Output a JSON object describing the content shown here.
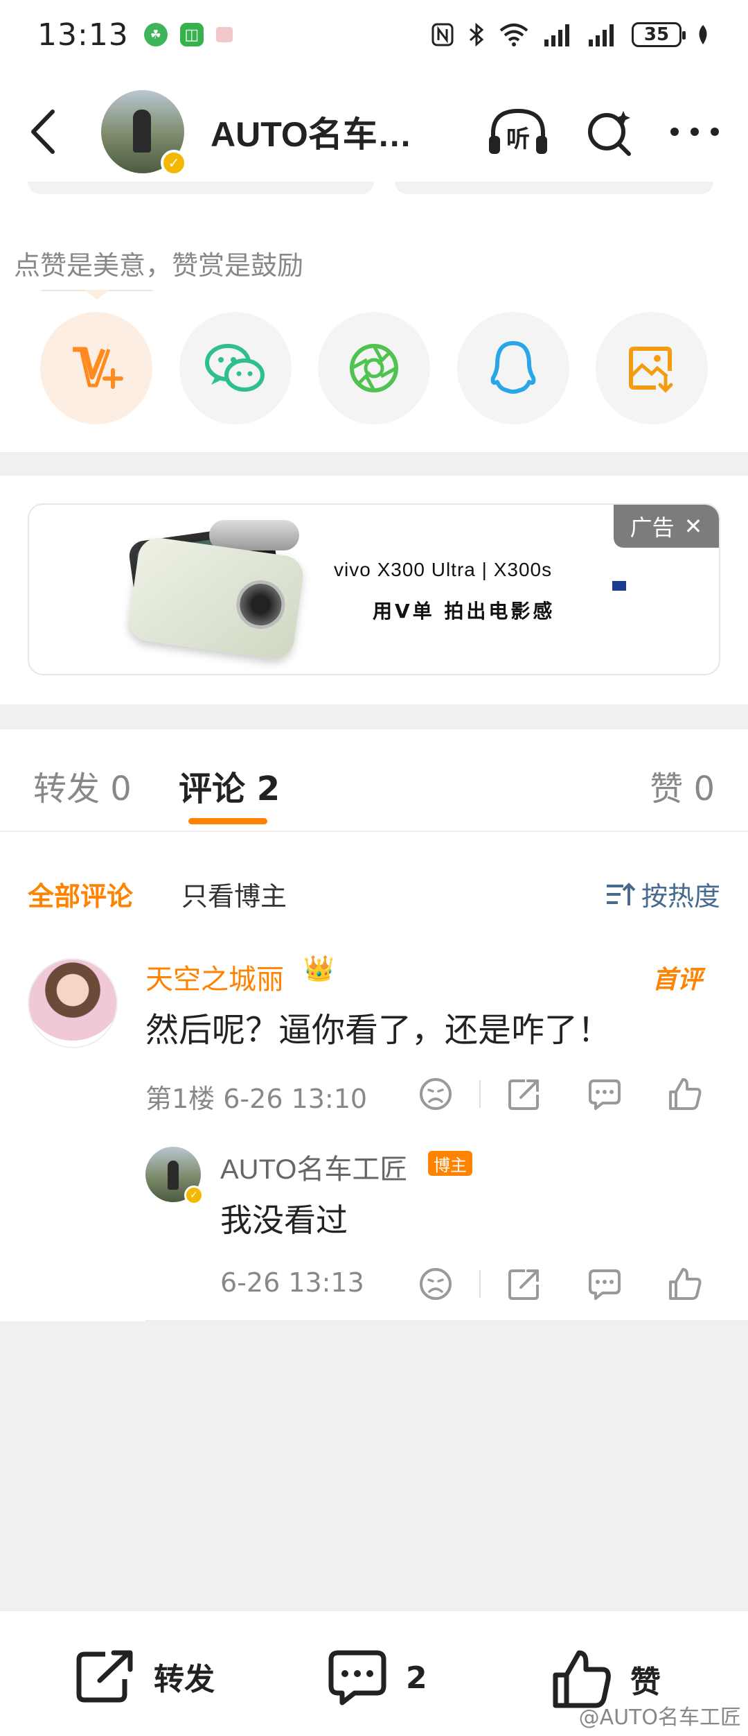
{
  "status_bar": {
    "time": "13:13",
    "battery": "35"
  },
  "nav": {
    "title": "AUTO名车…"
  },
  "prompt_text": "点赞是美意，赞赏是鼓励",
  "share_options": [
    {
      "icon": "v-plus-icon"
    },
    {
      "icon": "wechat-icon"
    },
    {
      "icon": "moments-icon"
    },
    {
      "icon": "qq-icon"
    },
    {
      "icon": "save-image-icon"
    }
  ],
  "ad": {
    "tag": "广告",
    "brand": "vivo X300 Ultra | X300s",
    "slogan": "用V单  拍出电影感"
  },
  "tabs": [
    {
      "label": "转发 0"
    },
    {
      "label": "评论 2"
    },
    {
      "label": "赞 0"
    }
  ],
  "filters": {
    "all": "全部评论",
    "blogger_only": "只看博主",
    "sort": "按热度"
  },
  "comments": [
    {
      "author": "天空之城丽",
      "badge": "首评",
      "text": "然后呢？逼你看了，还是咋了！",
      "meta": "第1楼  6-26 13:10",
      "reply": {
        "author": "AUTO名车工匠",
        "badge": "博主",
        "text": "我没看过",
        "meta": "6-26 13:13"
      }
    }
  ],
  "bottom_bar": {
    "repost": "转发",
    "comment_count": "2",
    "like": "赞"
  },
  "watermark": "@AUTO名车工匠",
  "colors": {
    "accent": "#ff8200",
    "link_blue": "#466b8f",
    "band_gray": "#f0f0f0"
  }
}
